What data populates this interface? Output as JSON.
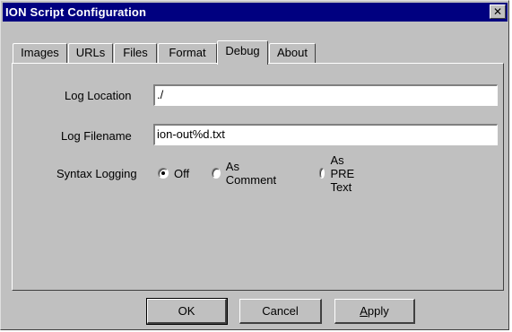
{
  "window": {
    "title": "ION Script Configuration",
    "close_glyph": "✕"
  },
  "tabs": [
    {
      "label": "Images",
      "active": false
    },
    {
      "label": "URLs",
      "active": false
    },
    {
      "label": "Files",
      "active": false
    },
    {
      "label": "Format",
      "active": false
    },
    {
      "label": "Debug",
      "active": true
    },
    {
      "label": "About",
      "active": false
    }
  ],
  "debug": {
    "log_location": {
      "label": "Log Location",
      "value": "./"
    },
    "log_filename": {
      "label": "Log Filename",
      "value": "ion-out%d.txt"
    },
    "syntax_logging": {
      "label": "Syntax Logging",
      "options": [
        {
          "label": "Off",
          "selected": true
        },
        {
          "label": "As Comment",
          "selected": false
        },
        {
          "label": "As PRE Text",
          "selected": false
        }
      ]
    }
  },
  "buttons": {
    "ok": "OK",
    "cancel": "Cancel",
    "apply_prefix": "",
    "apply_underlined": "A",
    "apply_rest": "pply"
  },
  "colors": {
    "titlebar": "#000080",
    "face": "#c0c0c0"
  }
}
